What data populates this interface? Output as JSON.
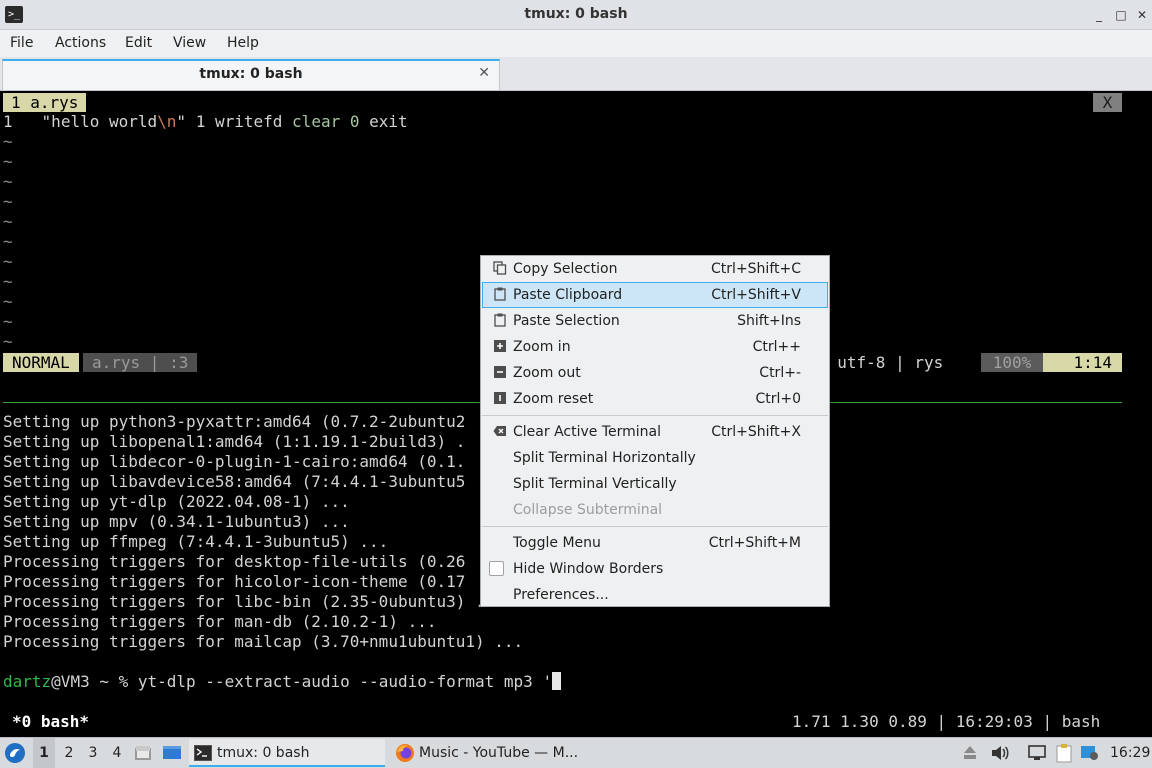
{
  "window": {
    "title": "tmux: 0 bash",
    "app_icon": "terminal-icon",
    "minimize": "_",
    "maximize": "□",
    "close": "✕"
  },
  "menubar": {
    "file": "File",
    "actions": "Actions",
    "edit": "Edit",
    "view": "View",
    "help": "Help"
  },
  "tab": {
    "label": "tmux: 0 bash",
    "close": "✕"
  },
  "vim": {
    "tab_label": "1 a.rys",
    "tab_close": "X",
    "line_number": "1",
    "code": {
      "str_open": "\"hello world",
      "esc": "\\n",
      "str_close": "\"",
      "num1": "1",
      "fn": "writefd",
      "kw": "clear",
      "num2": "0",
      "exit": "exit"
    },
    "tilde": "~",
    "mode": "NORMAL",
    "file_info": "a.rys | :3",
    "status_right": "| utf-8 | rys",
    "percent": "100%",
    "position": "1:14"
  },
  "shell": {
    "lines": [
      "Setting up python3-pyxattr:amd64 (0.7.2-2ubuntu2",
      "Setting up libopenal1:amd64 (1:1.19.1-2build3) .",
      "Setting up libdecor-0-plugin-1-cairo:amd64 (0.1.",
      "Setting up libavdevice58:amd64 (7:4.4.1-3ubuntu5",
      "Setting up yt-dlp (2022.04.08-1) ...",
      "Setting up mpv (0.34.1-1ubuntu3) ...",
      "Setting up ffmpeg (7:4.4.1-3ubuntu5) ...",
      "Processing triggers for desktop-file-utils (0.26",
      "Processing triggers for hicolor-icon-theme (0.17",
      "Processing triggers for libc-bin (2.35-0ubuntu3) ...",
      "Processing triggers for man-db (2.10.2-1) ...",
      "Processing triggers for mailcap (3.70+nmu1ubuntu1) ..."
    ],
    "prompt_user": "dartz",
    "prompt_rest": "@VM3 ~ % yt-dlp --extract-audio --audio-format mp3 '"
  },
  "tmux_status": {
    "window": "*0 bash*",
    "right": "1.71 1.30 0.89 | 16:29:03 | bash"
  },
  "context_menu": {
    "items": [
      {
        "label": "Copy Selection",
        "shortcut": "Ctrl+Shift+C",
        "icon": "copy-icon"
      },
      {
        "label": "Paste Clipboard",
        "shortcut": "Ctrl+Shift+V",
        "icon": "paste-icon"
      },
      {
        "label": "Paste Selection",
        "shortcut": "Shift+Ins",
        "icon": "paste-icon"
      },
      {
        "label": "Zoom in",
        "shortcut": "Ctrl++",
        "icon": "zoom-in-icon"
      },
      {
        "label": "Zoom out",
        "shortcut": "Ctrl+-",
        "icon": "zoom-out-icon"
      },
      {
        "label": "Zoom reset",
        "shortcut": "Ctrl+0",
        "icon": "zoom-reset-icon"
      },
      {
        "label": "Clear Active Terminal",
        "shortcut": "Ctrl+Shift+X",
        "icon": "clear-icon"
      },
      {
        "label": "Split Terminal Horizontally",
        "shortcut": ""
      },
      {
        "label": "Split Terminal Vertically",
        "shortcut": ""
      },
      {
        "label": "Collapse Subterminal",
        "shortcut": "",
        "disabled": true
      },
      {
        "label": "Toggle Menu",
        "shortcut": "Ctrl+Shift+M"
      },
      {
        "label": "Hide Window Borders",
        "shortcut": "",
        "checked": false
      },
      {
        "label": "Preferences...",
        "shortcut": ""
      }
    ]
  },
  "taskbar": {
    "menu_icon": "start-menu-icon",
    "desktops": [
      "1",
      "2",
      "3",
      "4"
    ],
    "tasks": [
      {
        "label": "tmux: 0 bash",
        "icon": "terminal-icon"
      },
      {
        "label": "Music - YouTube — M...",
        "icon": "firefox-icon"
      }
    ],
    "clock": "16:29"
  },
  "colors": {
    "accent": "#3daee9",
    "vim_highlight": "#d7d7a8",
    "prompt_green": "#2fb84a",
    "pane_border": "#3fa33f"
  }
}
